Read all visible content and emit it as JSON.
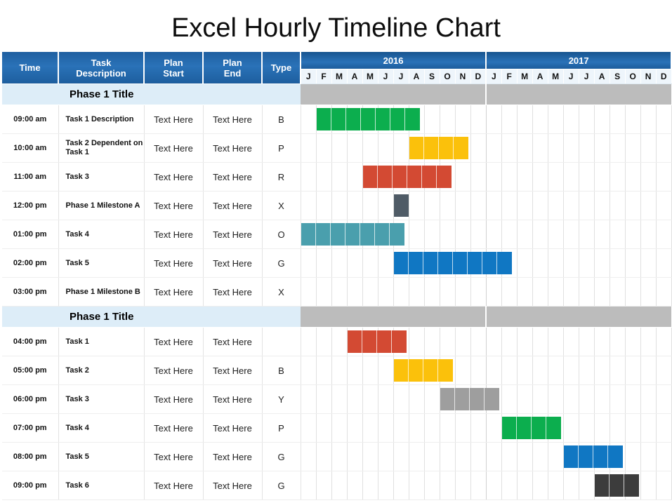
{
  "page": {
    "title": "Excel Hourly Timeline Chart"
  },
  "columns": {
    "time": "Time",
    "task_description_line1": "Task",
    "task_description_line2": "Description",
    "plan_start_line1": "Plan",
    "plan_start_line2": "Start",
    "plan_end_line1": "Plan",
    "plan_end_line2": "End",
    "type": "Type"
  },
  "timeline": {
    "years": [
      {
        "label": "2016",
        "span": 12
      },
      {
        "label": "2017",
        "span": 12
      }
    ],
    "months": [
      "J",
      "F",
      "M",
      "A",
      "M",
      "J",
      "J",
      "A",
      "S",
      "O",
      "N",
      "D",
      "J",
      "F",
      "M",
      "A",
      "M",
      "J",
      "J",
      "A",
      "S",
      "O",
      "N",
      "D"
    ]
  },
  "colors": {
    "header_blue": "#2a72b8",
    "phase_band_blue": "#ddedf8",
    "phase_bar_gray": "#bcbcbc",
    "green": "#0cae4e",
    "yellow": "#fbc10b",
    "red": "#d34a33",
    "slate": "#4f5b66",
    "teal": "#4a9fad",
    "blue": "#1077c3",
    "gray": "#9e9e9e",
    "darkgray": "#3c3c3c"
  },
  "sections": [
    {
      "phase_title": "Phase 1  Title",
      "rows": [
        {
          "time": "09:00 am",
          "description": "Task 1 Description",
          "plan_start": "Text Here",
          "plan_end": "Text Here",
          "type": "B",
          "bar": {
            "start": 1,
            "length": 7,
            "color": "#0cae4e"
          }
        },
        {
          "time": "10:00 am",
          "description": "Task 2 Dependent on Task 1",
          "plan_start": "Text Here",
          "plan_end": "Text Here",
          "type": "P",
          "bar": {
            "start": 7,
            "length": 4,
            "color": "#fbc10b"
          }
        },
        {
          "time": "11:00 am",
          "description": "Task 3",
          "plan_start": "Text Here",
          "plan_end": "Text Here",
          "type": "R",
          "bar": {
            "start": 4,
            "length": 6,
            "color": "#d34a33"
          }
        },
        {
          "time": "12:00 pm",
          "description": "Phase 1 Milestone A",
          "plan_start": "Text Here",
          "plan_end": "Text Here",
          "type": "X",
          "bar": {
            "start": 6,
            "length": 1,
            "color": "#4f5b66"
          }
        },
        {
          "time": "01:00 pm",
          "description": "Task 4",
          "plan_start": "Text Here",
          "plan_end": "Text Here",
          "type": "O",
          "bar": {
            "start": 0,
            "length": 7,
            "color": "#4a9fad"
          }
        },
        {
          "time": "02:00 pm",
          "description": "Task 5",
          "plan_start": "Text Here",
          "plan_end": "Text Here",
          "type": "G",
          "bar": {
            "start": 6,
            "length": 8,
            "color": "#1077c3"
          }
        },
        {
          "time": "03:00 pm",
          "description": "Phase 1 Milestone B",
          "plan_start": "Text Here",
          "plan_end": "Text Here",
          "type": "X",
          "bar": null
        }
      ]
    },
    {
      "phase_title": "Phase 1  Title",
      "rows": [
        {
          "time": "04:00 pm",
          "description": "Task 1",
          "plan_start": "Text Here",
          "plan_end": "Text Here",
          "type": "",
          "bar": {
            "start": 3,
            "length": 4,
            "color": "#d34a33"
          }
        },
        {
          "time": "05:00 pm",
          "description": "Task 2",
          "plan_start": "Text Here",
          "plan_end": "Text Here",
          "type": "B",
          "bar": {
            "start": 6,
            "length": 4,
            "color": "#fbc10b"
          }
        },
        {
          "time": "06:00 pm",
          "description": "Task 3",
          "plan_start": "Text Here",
          "plan_end": "Text Here",
          "type": "Y",
          "bar": {
            "start": 9,
            "length": 4,
            "color": "#9e9e9e"
          }
        },
        {
          "time": "07:00 pm",
          "description": "Task 4",
          "plan_start": "Text Here",
          "plan_end": "Text Here",
          "type": "P",
          "bar": {
            "start": 13,
            "length": 4,
            "color": "#0cae4e"
          }
        },
        {
          "time": "08:00 pm",
          "description": "Task 5",
          "plan_start": "Text Here",
          "plan_end": "Text Here",
          "type": "G",
          "bar": {
            "start": 17,
            "length": 4,
            "color": "#1077c3"
          }
        },
        {
          "time": "09:00 pm",
          "description": "Task 6",
          "plan_start": "Text Here",
          "plan_end": "Text Here",
          "type": "G",
          "bar": {
            "start": 19,
            "length": 3,
            "color": "#3c3c3c"
          }
        }
      ]
    }
  ],
  "chart_data": {
    "type": "bar",
    "title": "Excel Hourly Timeline Chart",
    "xlabel": "",
    "ylabel": "",
    "categories": [
      "J 2016",
      "F 2016",
      "M 2016",
      "A 2016",
      "M 2016",
      "J 2016",
      "J 2016",
      "A 2016",
      "S 2016",
      "O 2016",
      "N 2016",
      "D 2016",
      "J 2017",
      "F 2017",
      "M 2017",
      "A 2017",
      "M 2017",
      "J 2017",
      "J 2017",
      "A 2017",
      "S 2017",
      "O 2017",
      "N 2017",
      "D 2017"
    ],
    "series": [
      {
        "name": "09:00 am - Task 1 Description",
        "start_month_index": 1,
        "length_months": 7,
        "color": "#0cae4e"
      },
      {
        "name": "10:00 am - Task 2 Dependent on Task 1",
        "start_month_index": 7,
        "length_months": 4,
        "color": "#fbc10b"
      },
      {
        "name": "11:00 am - Task 3",
        "start_month_index": 4,
        "length_months": 6,
        "color": "#d34a33"
      },
      {
        "name": "12:00 pm - Phase 1 Milestone A",
        "start_month_index": 6,
        "length_months": 1,
        "color": "#4f5b66"
      },
      {
        "name": "01:00 pm - Task 4",
        "start_month_index": 0,
        "length_months": 7,
        "color": "#4a9fad"
      },
      {
        "name": "02:00 pm - Task 5",
        "start_month_index": 6,
        "length_months": 8,
        "color": "#1077c3"
      },
      {
        "name": "03:00 pm - Phase 1 Milestone B",
        "start_month_index": null,
        "length_months": 0,
        "color": null
      },
      {
        "name": "04:00 pm - Task 1",
        "start_month_index": 3,
        "length_months": 4,
        "color": "#d34a33"
      },
      {
        "name": "05:00 pm - Task 2",
        "start_month_index": 6,
        "length_months": 4,
        "color": "#fbc10b"
      },
      {
        "name": "06:00 pm - Task 3",
        "start_month_index": 9,
        "length_months": 4,
        "color": "#9e9e9e"
      },
      {
        "name": "07:00 pm - Task 4",
        "start_month_index": 13,
        "length_months": 4,
        "color": "#0cae4e"
      },
      {
        "name": "08:00 pm - Task 5",
        "start_month_index": 17,
        "length_months": 4,
        "color": "#1077c3"
      },
      {
        "name": "09:00 pm - Task 6",
        "start_month_index": 19,
        "length_months": 3,
        "color": "#3c3c3c"
      }
    ]
  }
}
